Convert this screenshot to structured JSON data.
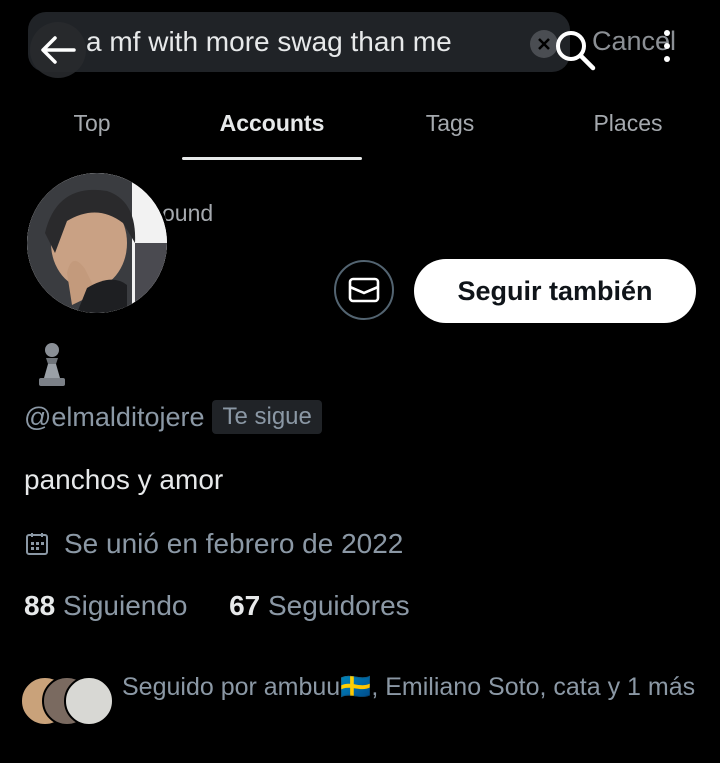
{
  "search": {
    "query": "a mf with more swag than me",
    "cancel_label": "Cancel"
  },
  "tabs": [
    {
      "label": "Top"
    },
    {
      "label": "Accounts"
    },
    {
      "label": "Tags"
    },
    {
      "label": "Places"
    }
  ],
  "active_tab": "Accounts",
  "profile": {
    "obscured_text": "ound",
    "follow_label": "Seguir también",
    "handle": "@elmalditojere",
    "follows_you_badge": "Te sigue",
    "bio": "panchos y amor",
    "joined": "Se unió en febrero de 2022",
    "following_count": "88",
    "following_label": "Siguiendo",
    "followers_count": "67",
    "followers_label": "Seguidores",
    "followed_by": "Seguido por ambuu🇸🇪, Emiliano Soto, cata y 1 más"
  },
  "colors": {
    "background": "#000000",
    "primary_text": "#e7e9ea",
    "secondary_text": "#8b98a5",
    "follow_button_bg": "#ffffff"
  },
  "icons": {
    "back": "arrow-left-icon",
    "search": "search-icon",
    "clear": "clear-icon",
    "more": "more-vertical-icon",
    "message": "mail-icon",
    "emoji": "chess-pawn-icon",
    "calendar": "calendar-icon"
  }
}
